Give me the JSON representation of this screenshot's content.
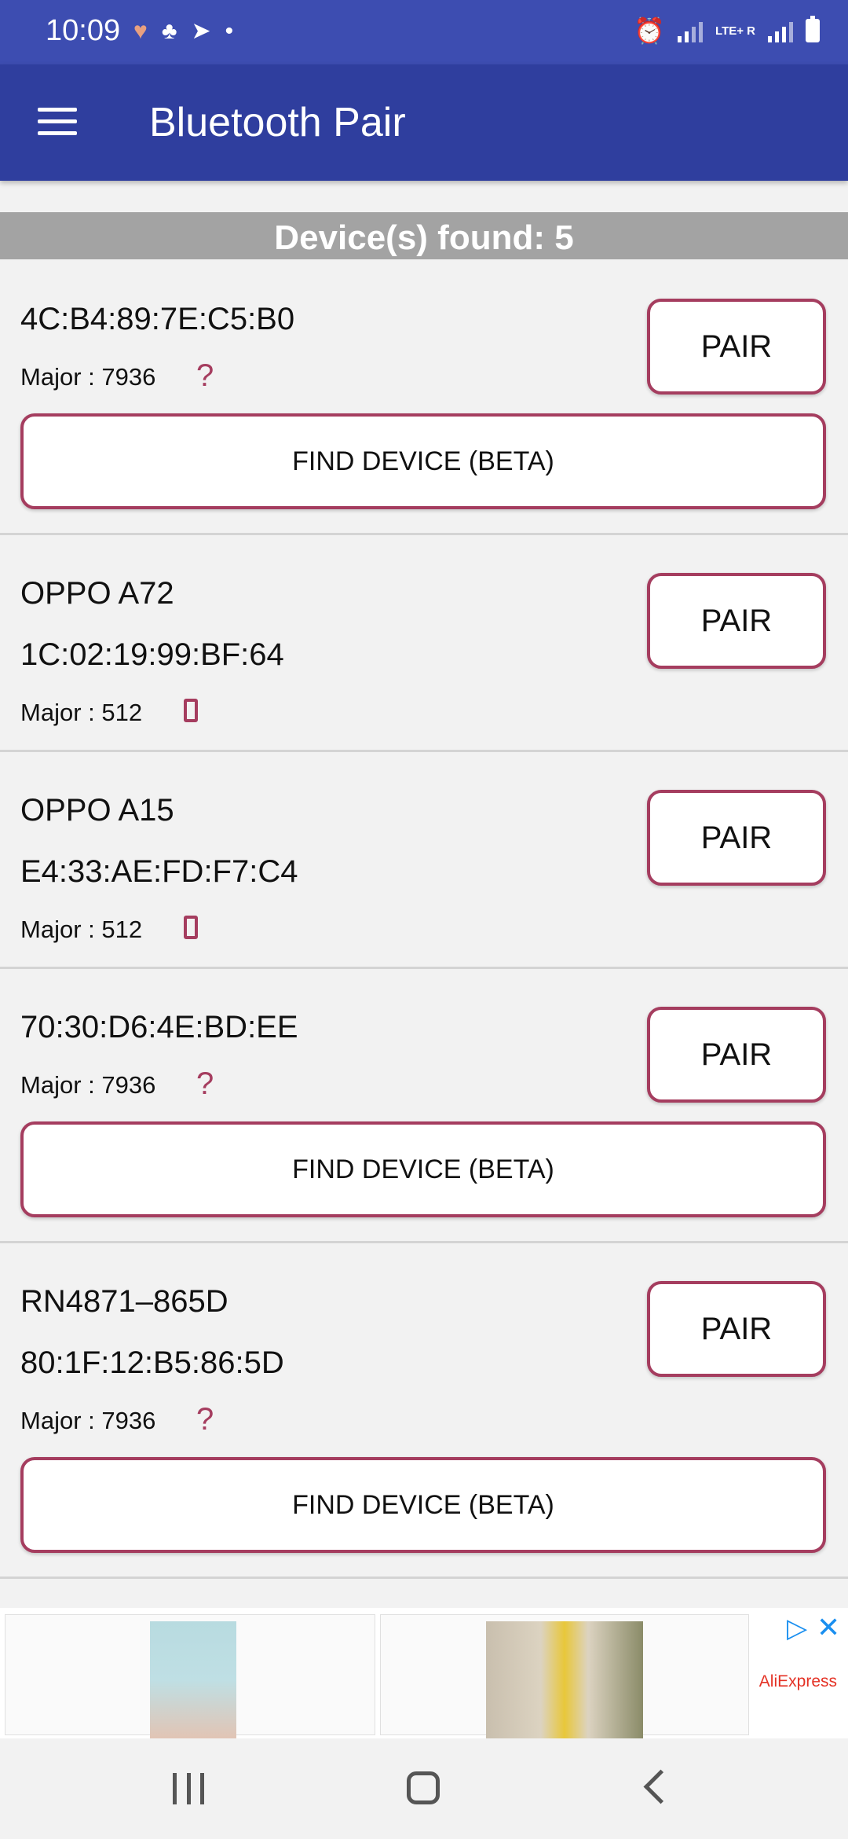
{
  "status_bar": {
    "time": "10:09",
    "network": "LTE+ R"
  },
  "app_bar": {
    "title": "Bluetooth Pair"
  },
  "found": {
    "text": "Device(s) found: 5"
  },
  "buttons": {
    "pair": "PAIR",
    "find": "FIND DEVICE (BETA)"
  },
  "devices": [
    {
      "name": "",
      "address": "4C:B4:89:7E:C5:B0",
      "major": "Major : 7936",
      "type_icon": "unknown-device-icon"
    },
    {
      "name": "OPPO A72",
      "address": "1C:02:19:99:BF:64",
      "major": "Major : 512",
      "type_icon": "phone-icon"
    },
    {
      "name": "OPPO A15",
      "address": "E4:33:AE:FD:F7:C4",
      "major": "Major : 512",
      "type_icon": "phone-icon"
    },
    {
      "name": "",
      "address": "70:30:D6:4E:BD:EE",
      "major": "Major : 7936",
      "type_icon": "unknown-device-icon"
    },
    {
      "name": "RN4871–865D",
      "address": "80:1F:12:B5:86:5D",
      "major": "Major : 7936",
      "type_icon": "unknown-device-icon"
    }
  ],
  "ad": {
    "brand": "AliExpress"
  },
  "colors": {
    "status_bar": "#3d4db1",
    "app_bar": "#2f3e9e",
    "accent_border": "#a53d5f",
    "found_bar": "#a3a3a3"
  }
}
